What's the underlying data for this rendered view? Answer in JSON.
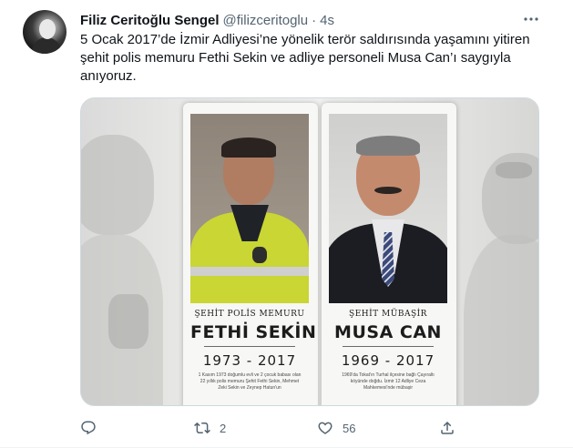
{
  "tweet": {
    "author_name": "Filiz Ceritoğlu Sengel",
    "author_handle": "@filizceritoglu",
    "separator": "·",
    "time": "4s",
    "text_lines": [
      "5 Ocak 2017’de İzmir Adliyesi’ne yönelik terör saldırısında yaşamını yitiren",
      "şehit polis memuru Fethi Sekin ve adliye personeli Musa Can’ı saygıyla",
      "anıyoruz."
    ]
  },
  "media": {
    "plaques": [
      {
        "title": "ŞEHİT POLİS MEMURU",
        "name": "FETHİ SEKİN",
        "years": "1973 - 2017",
        "description": "1 Kasım 1973 doğumlu evli ve 2 çocuk babası olan 22 yıllık polis memuru Şehit Fethi Sekin, Mehmet Zeki Sekin ve Zeynep Hatun'un"
      },
      {
        "title": "ŞEHİT MÜBAŞİR",
        "name": "MUSA CAN",
        "years": "1969 - 2017",
        "description": "1969'da Tokat'ın Turhal ilçesine bağlı Çayıraltı köyünde doğdu. İzmir 12 Adliye Ceza Mahkemesi'nde mübaşir"
      }
    ]
  },
  "actions": {
    "reply_count": "",
    "retweet_count": "2",
    "like_count": "56",
    "share_count": ""
  },
  "icons": {
    "more": "more-horizontal-icon",
    "reply": "reply-icon",
    "retweet": "retweet-icon",
    "like": "heart-icon",
    "share": "share-icon"
  },
  "colors": {
    "text_primary": "#0f1419",
    "text_secondary": "#536471",
    "border": "#cfd9de"
  }
}
